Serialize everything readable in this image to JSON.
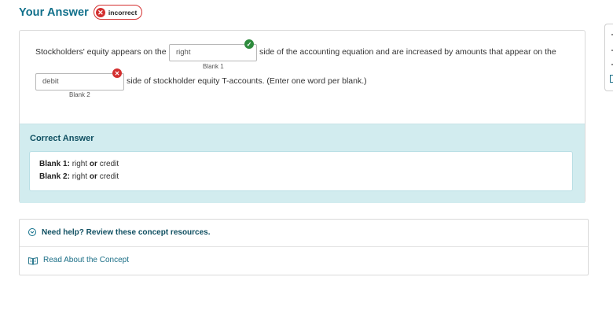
{
  "header": {
    "title": "Your Answer",
    "status_badge": "incorrect"
  },
  "question": {
    "part1": "Stockholders' equity appears on the",
    "blank1_value": "right",
    "blank1_label": "Blank 1",
    "blank1_status": "correct",
    "part2": "side of the accounting equation and are increased by amounts that appear on the",
    "blank2_value": "debit",
    "blank2_label": "Blank 2",
    "blank2_status": "incorrect",
    "part3": "side of stockholder equity T-accounts. (Enter one word per blank.)"
  },
  "correct_answer": {
    "title": "Correct Answer",
    "lines": [
      {
        "label": "Blank 1:",
        "opt1": "right",
        "sep": "or",
        "opt2": "credit"
      },
      {
        "label": "Blank 2:",
        "opt1": "right",
        "sep": "or",
        "opt2": "credit"
      }
    ]
  },
  "help": {
    "toggle_label": "Need help? Review these concept resources.",
    "resource_label": "Read About the Concept"
  },
  "colors": {
    "accent": "#0f6f8a",
    "correct": "#2e8b3d",
    "incorrect": "#d32f2f",
    "correct_bg": "#d2ecef"
  }
}
